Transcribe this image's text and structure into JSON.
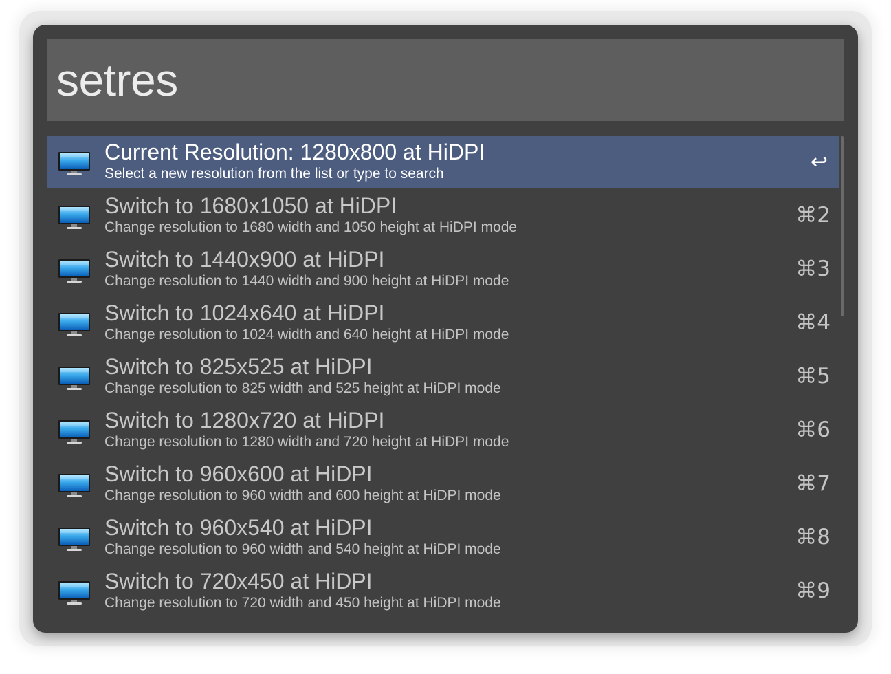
{
  "search": {
    "query": "setres"
  },
  "results": [
    {
      "title": "Current Resolution: 1280x800 at HiDPI",
      "subtitle": "Select a new resolution from the list or type to search",
      "shortcut": "↩",
      "icon": "display-icon",
      "selected": true
    },
    {
      "title": "Switch to 1680x1050 at HiDPI",
      "subtitle": "Change resolution to 1680 width and 1050 height at HiDPI mode",
      "shortcut": "⌘2",
      "icon": "display-icon"
    },
    {
      "title": "Switch to 1440x900 at HiDPI",
      "subtitle": "Change resolution to 1440 width and 900 height at HiDPI mode",
      "shortcut": "⌘3",
      "icon": "display-icon"
    },
    {
      "title": "Switch to 1024x640 at HiDPI",
      "subtitle": "Change resolution to 1024 width and 640 height at HiDPI mode",
      "shortcut": "⌘4",
      "icon": "display-icon"
    },
    {
      "title": "Switch to 825x525 at HiDPI",
      "subtitle": "Change resolution to 825 width and 525 height at HiDPI mode",
      "shortcut": "⌘5",
      "icon": "display-icon"
    },
    {
      "title": "Switch to 1280x720 at HiDPI",
      "subtitle": "Change resolution to 1280 width and 720 height at HiDPI mode",
      "shortcut": "⌘6",
      "icon": "display-icon"
    },
    {
      "title": "Switch to 960x600 at HiDPI",
      "subtitle": "Change resolution to 960 width and 600 height at HiDPI mode",
      "shortcut": "⌘7",
      "icon": "display-icon"
    },
    {
      "title": "Switch to 960x540 at HiDPI",
      "subtitle": "Change resolution to 960 width and 540 height at HiDPI mode",
      "shortcut": "⌘8",
      "icon": "display-icon"
    },
    {
      "title": "Switch to 720x450 at HiDPI",
      "subtitle": "Change resolution to 720 width and 450 height at HiDPI mode",
      "shortcut": "⌘9",
      "icon": "display-icon"
    }
  ],
  "colors": {
    "window_bg": "#404040",
    "search_bg": "#5e5e5e",
    "selection": "#4d5d80",
    "text_primary": "#c8c8c8",
    "text_selected": "#ffffff"
  }
}
